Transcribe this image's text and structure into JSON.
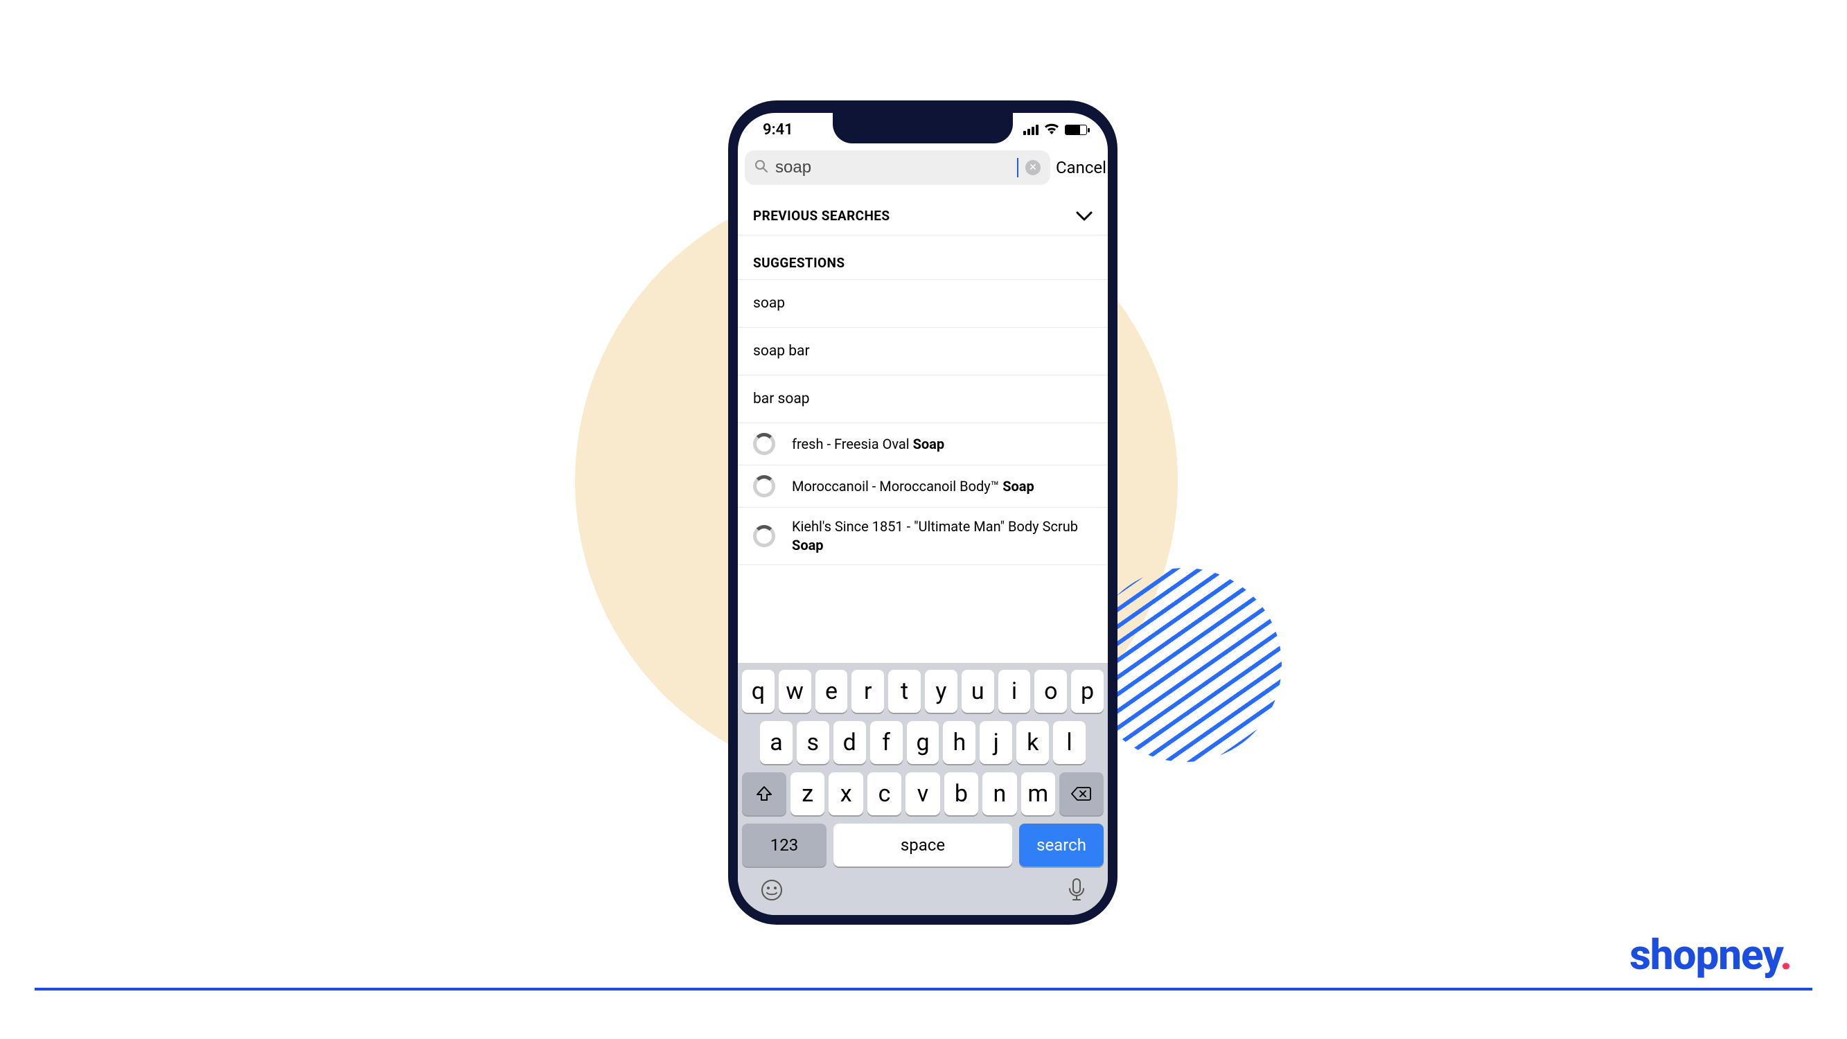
{
  "status": {
    "time": "9:41"
  },
  "search": {
    "value": "soap",
    "cancel_label": "Cancel"
  },
  "sections": {
    "previous_label": "PREVIOUS SEARCHES",
    "suggestions_label": "SUGGESTIONS"
  },
  "suggestions": [
    "soap",
    "soap bar",
    "bar soap"
  ],
  "products": [
    {
      "prefix": "fresh - Freesia Oval ",
      "bold": "Soap",
      "suffix": ""
    },
    {
      "prefix": "Moroccanoil - Moroccanoil Body™ ",
      "bold": "Soap",
      "suffix": ""
    },
    {
      "prefix": "Kiehl's Since 1851 - \"Ultimate Man\" Body Scrub ",
      "bold": "Soap",
      "suffix": ""
    }
  ],
  "keyboard": {
    "row1": [
      "q",
      "w",
      "e",
      "r",
      "t",
      "y",
      "u",
      "i",
      "o",
      "p"
    ],
    "row2": [
      "a",
      "s",
      "d",
      "f",
      "g",
      "h",
      "j",
      "k",
      "l"
    ],
    "row3": [
      "z",
      "x",
      "c",
      "v",
      "b",
      "n",
      "m"
    ],
    "num_label": "123",
    "space_label": "space",
    "search_label": "search"
  },
  "brand": {
    "name": "shopney",
    "dot": "."
  }
}
